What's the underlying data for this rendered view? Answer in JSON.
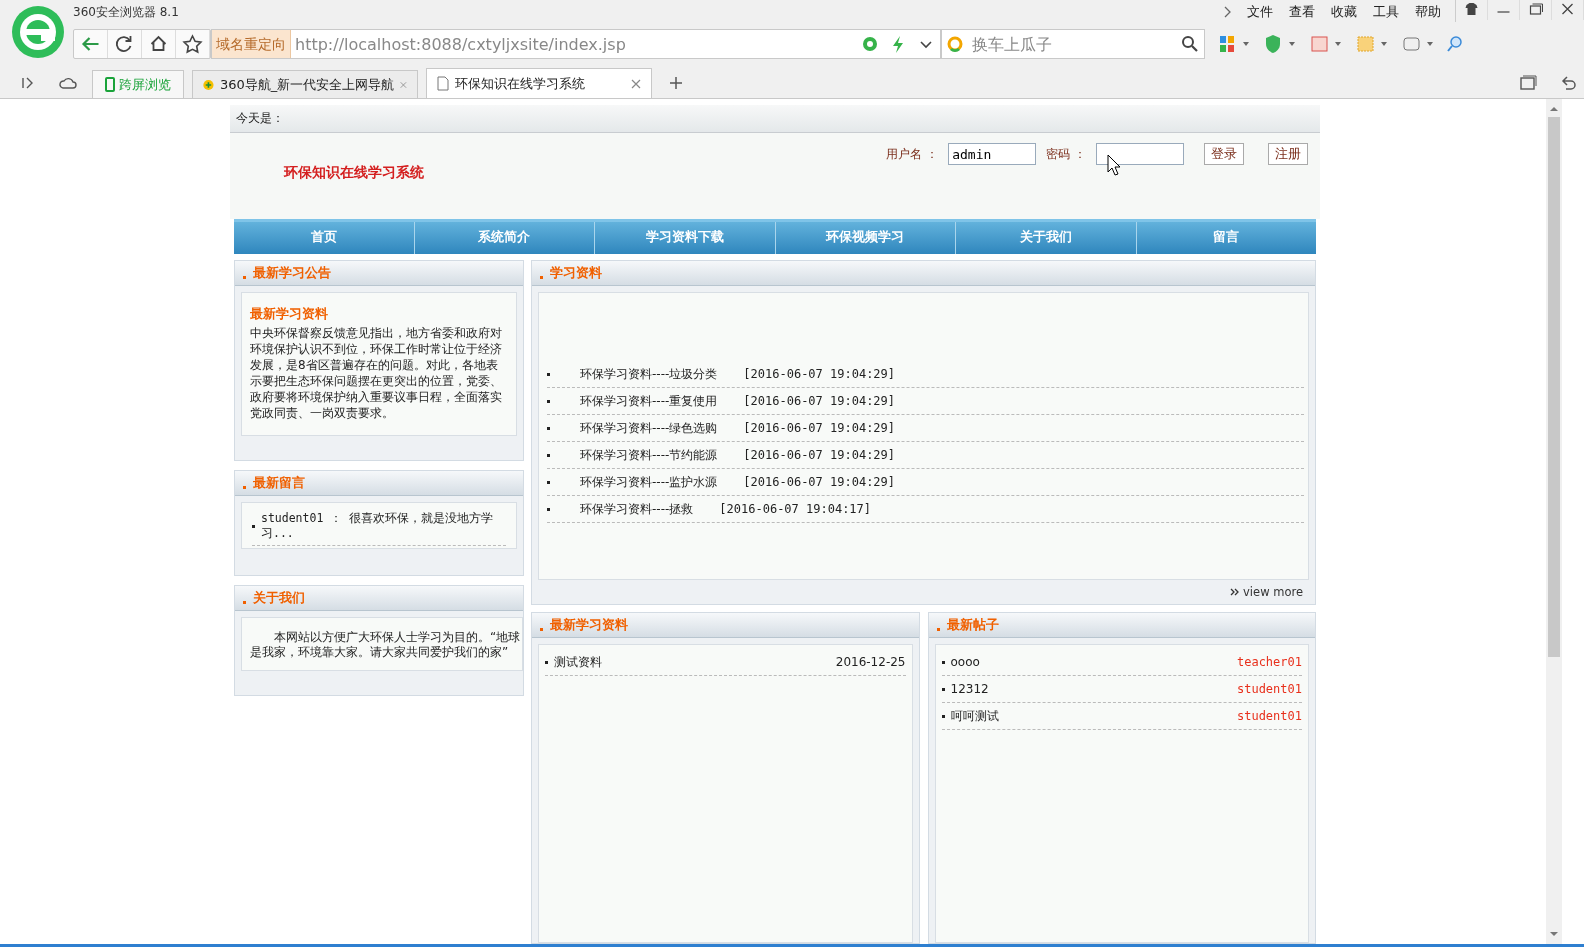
{
  "browser": {
    "title": "360安全浏览器 8.1",
    "menu": [
      "文件",
      "查看",
      "收藏",
      "工具",
      "帮助"
    ],
    "redirect_badge": "域名重定向",
    "url": "http://localhost:8088/cxtyljxsite/index.jsp",
    "search_placeholder": "换车上瓜子",
    "split_screen": "跨屏浏览",
    "tabs": [
      {
        "label": "360导航_新一代安全上网导航",
        "selected": false,
        "kind": "nav"
      },
      {
        "label": "环保知识在线学习系统",
        "selected": true,
        "kind": "page"
      }
    ]
  },
  "page": {
    "date_label": "今天是：",
    "login": {
      "username_label": "用户名 ：",
      "username": "admin",
      "password_label": "密码 ：",
      "buttons": [
        "登录",
        "注册"
      ]
    },
    "site_title": "环保知识在线学习系统",
    "nav": [
      "首页",
      "系统简介",
      "学习资料下载",
      "环保视频学习",
      "关于我们",
      "留言"
    ],
    "announcement": {
      "title": "最新学习公告",
      "heading": "最新学习资料",
      "body": "中央环保督察反馈意见指出，地方省委和政府对环境保护认识不到位，环保工作时常让位于经济发展，是8省区普遍存在的问题。对此，各地表示要把生态环保问题摆在更突出的位置，党委、政府要将环境保护纳入重要议事日程，全面落实党政同责、一岗双责要求。"
    },
    "messages": {
      "title": "最新留言",
      "items": [
        {
          "text": "student01 ： 很喜欢环保，就是没地方学习..."
        }
      ]
    },
    "about": {
      "title": "关于我们",
      "body": "本网站以方便广大环保人士学习为目的。“地球是我家，环境靠大家。请大家共同爱护我们的家”"
    },
    "materials": {
      "title": "学习资料",
      "more": "view more",
      "items": [
        {
          "title": "环保学习资料----垃圾分类",
          "time": "[2016-06-07 19:04:29]"
        },
        {
          "title": "环保学习资料----重复使用",
          "time": "[2016-06-07 19:04:29]"
        },
        {
          "title": "环保学习资料----绿色选购",
          "time": "[2016-06-07 19:04:29]"
        },
        {
          "title": "环保学习资料----节约能源",
          "time": "[2016-06-07 19:04:29]"
        },
        {
          "title": "环保学习资料----监护水源",
          "time": "[2016-06-07 19:04:29]"
        },
        {
          "title": "环保学习资料----拯救",
          "time": "[2016-06-07 19:04:17]"
        }
      ]
    },
    "latest": {
      "title": "最新学习资料",
      "items": [
        {
          "title": "测试资料",
          "date": "2016-12-25"
        }
      ]
    },
    "posts": {
      "title": "最新帖子",
      "items": [
        {
          "title": "oooo",
          "author": "teacher01"
        },
        {
          "title": "12312",
          "author": "student01"
        },
        {
          "title": "呵呵测试",
          "author": "student01"
        }
      ]
    }
  }
}
